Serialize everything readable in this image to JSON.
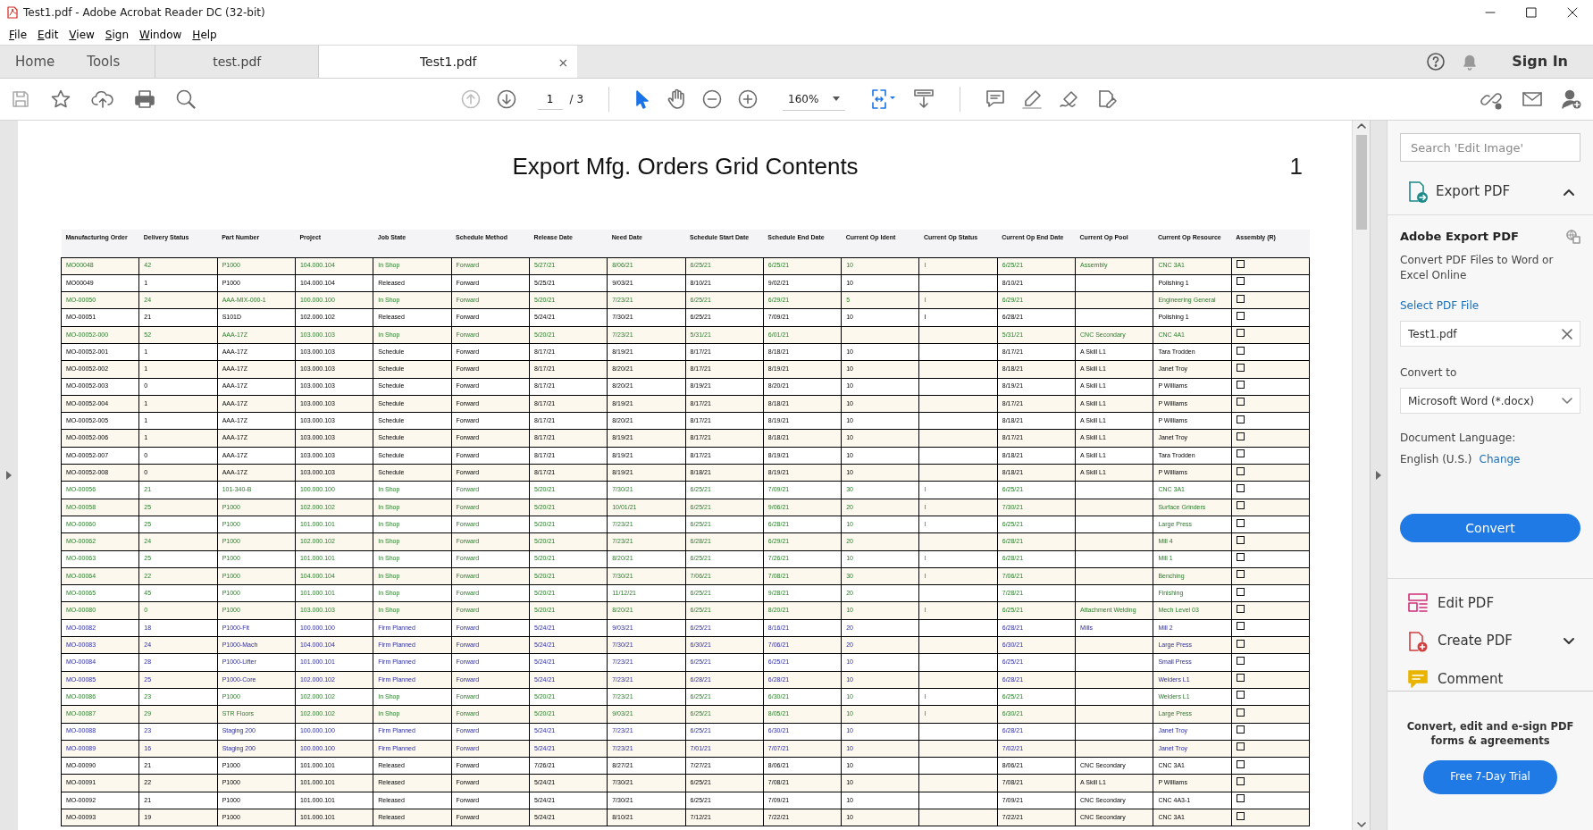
{
  "window": {
    "title": "Test1.pdf - Adobe Acrobat Reader DC (32-bit)"
  },
  "menu": [
    "File",
    "Edit",
    "View",
    "Sign",
    "Window",
    "Help"
  ],
  "tabs": [
    {
      "label": "Home",
      "kind": "nav",
      "selected": false
    },
    {
      "label": "Tools",
      "kind": "nav",
      "selected": false
    },
    {
      "label": "test.pdf",
      "kind": "doc",
      "selected": false
    },
    {
      "label": "Test1.pdf",
      "kind": "doc",
      "selected": true,
      "close": "×"
    }
  ],
  "account": {
    "sign_in": "Sign In"
  },
  "toolbar": {
    "page": "1",
    "page_count": "/ 3",
    "zoom": "160%"
  },
  "document": {
    "title": "Export Mfg. Orders Grid Contents",
    "page_number": "1",
    "table": {
      "columns": [
        "Manufacturing Order",
        "Delivery Status",
        "Part Number",
        "Project",
        "Job State",
        "Schedule Method",
        "Release Date",
        "Need Date",
        "Schedule Start Date",
        "Schedule End Date",
        "Current Op Ident",
        "Current Op Status",
        "Current Op End Date",
        "Current Op Pool",
        "Current Op Resource",
        "Assembly (R)"
      ],
      "rows": [
        {
          "kind": "active",
          "checked": false,
          "cells": [
            "MO00048",
            "42",
            "P1000",
            "104.000.104",
            "In Shop",
            "Forward",
            "5/27/21",
            "8/06/21",
            "6/25/21",
            "6/25/21",
            "10",
            "I",
            "6/25/21",
            "Assembly",
            "CNC 3A1"
          ]
        },
        {
          "kind": "standard",
          "checked": false,
          "cells": [
            "MO00049",
            "1",
            "P1000",
            "104.000.104",
            "Released",
            "Forward",
            "5/25/21",
            "9/03/21",
            "8/10/21",
            "9/02/21",
            "10",
            null,
            "8/10/21",
            null,
            "Polishing 1"
          ]
        },
        {
          "kind": "active",
          "checked": false,
          "cells": [
            "MO-00050",
            "24",
            "AAA-MIX-000-1",
            "100.000.100",
            "In Shop",
            "Forward",
            "5/20/21",
            "7/23/21",
            "6/25/21",
            "6/29/21",
            "5",
            "I",
            "6/29/21",
            null,
            "Engineering General"
          ]
        },
        {
          "kind": "standard",
          "checked": false,
          "cells": [
            "MO-00051",
            "21",
            "S101D",
            "102.000.102",
            "Released",
            "Forward",
            "5/24/21",
            "7/30/21",
            "6/25/21",
            "7/09/21",
            "10",
            "I",
            "6/28/21",
            null,
            "Polishing 1"
          ]
        },
        {
          "kind": "active",
          "checked": false,
          "cells": [
            "MO-00052-000",
            "52",
            "AAA-17Z",
            "103.000.103",
            "In Shop",
            "Forward",
            "5/20/21",
            "7/23/21",
            "5/31/21",
            "6/01/21",
            null,
            null,
            "5/31/21",
            "CNC Secondary",
            "CNC 4A1"
          ]
        },
        {
          "kind": "standard",
          "checked": false,
          "cells": [
            "MO-00052-001",
            "1",
            "AAA-17Z",
            "103.000.103",
            "Schedule",
            "Forward",
            "8/17/21",
            "8/19/21",
            "8/17/21",
            "8/18/21",
            "10",
            null,
            "8/17/21",
            "A Skill L1",
            "Tara Trodden"
          ]
        },
        {
          "kind": "standard",
          "checked": false,
          "cells": [
            "MO-00052-002",
            "1",
            "AAA-17Z",
            "103.000.103",
            "Schedule",
            "Forward",
            "8/17/21",
            "8/20/21",
            "8/17/21",
            "8/19/21",
            "10",
            null,
            "8/18/21",
            "A Skill L1",
            "Janet Troy"
          ]
        },
        {
          "kind": "standard",
          "checked": false,
          "cells": [
            "MO-00052-003",
            "0",
            "AAA-17Z",
            "103.000.103",
            "Schedule",
            "Forward",
            "8/17/21",
            "8/20/21",
            "8/19/21",
            "8/20/21",
            "10",
            null,
            "8/19/21",
            "A Skill L1",
            "P Williams"
          ]
        },
        {
          "kind": "standard",
          "checked": false,
          "cells": [
            "MO-00052-004",
            "1",
            "AAA-17Z",
            "103.000.103",
            "Schedule",
            "Forward",
            "8/17/21",
            "8/19/21",
            "8/17/21",
            "8/18/21",
            "10",
            null,
            "8/17/21",
            "A Skill L1",
            "P Williams"
          ]
        },
        {
          "kind": "standard",
          "checked": false,
          "cells": [
            "MO-00052-005",
            "1",
            "AAA-17Z",
            "103.000.103",
            "Schedule",
            "Forward",
            "8/17/21",
            "8/20/21",
            "8/17/21",
            "8/19/21",
            "10",
            null,
            "8/18/21",
            "A Skill L1",
            "P Williams"
          ]
        },
        {
          "kind": "standard",
          "checked": false,
          "cells": [
            "MO-00052-006",
            "1",
            "AAA-17Z",
            "103.000.103",
            "Schedule",
            "Forward",
            "8/17/21",
            "8/19/21",
            "8/17/21",
            "8/18/21",
            "10",
            null,
            "8/17/21",
            "A Skill L1",
            "Janet Troy"
          ]
        },
        {
          "kind": "standard",
          "checked": false,
          "cells": [
            "MO-00052-007",
            "0",
            "AAA-17Z",
            "103.000.103",
            "Schedule",
            "Forward",
            "8/17/21",
            "8/19/21",
            "8/17/21",
            "8/19/21",
            "10",
            null,
            "8/18/21",
            "A Skill L1",
            "Tara Trodden"
          ]
        },
        {
          "kind": "standard",
          "checked": false,
          "cells": [
            "MO-00052-008",
            "0",
            "AAA-17Z",
            "103.000.103",
            "Schedule",
            "Forward",
            "8/17/21",
            "8/19/21",
            "8/18/21",
            "8/19/21",
            "10",
            null,
            "8/18/21",
            "A Skill L1",
            "P Williams"
          ]
        },
        {
          "kind": "active",
          "checked": false,
          "cells": [
            "MO-00056",
            "21",
            "101-340-B",
            "100.000.100",
            "In Shop",
            "Forward",
            "5/20/21",
            "7/30/21",
            "6/25/21",
            "7/09/21",
            "30",
            "I",
            "6/25/21",
            null,
            "CNC 3A1"
          ]
        },
        {
          "kind": "active",
          "checked": false,
          "cells": [
            "MO-00058",
            "25",
            "P1000",
            "102.000.102",
            "In Shop",
            "Forward",
            "5/20/21",
            "10/01/21",
            "6/25/21",
            "9/06/21",
            "20",
            "I",
            "7/30/21",
            null,
            "Surface Grinders"
          ]
        },
        {
          "kind": "active",
          "checked": false,
          "cells": [
            "MO-00060",
            "25",
            "P1000",
            "101.000.101",
            "In Shop",
            "Forward",
            "5/20/21",
            "7/23/21",
            "6/25/21",
            "6/28/21",
            "10",
            "I",
            "6/25/21",
            null,
            "Large Press"
          ]
        },
        {
          "kind": "active",
          "checked": false,
          "cells": [
            "MO-00062",
            "24",
            "P1000",
            "102.000.102",
            "In Shop",
            "Forward",
            "5/20/21",
            "7/23/21",
            "6/28/21",
            "6/29/21",
            "20",
            null,
            "6/28/21",
            null,
            "Mill 4"
          ]
        },
        {
          "kind": "active",
          "checked": false,
          "cells": [
            "MO-00063",
            "25",
            "P1000",
            "101.000.101",
            "In Shop",
            "Forward",
            "5/20/21",
            "8/20/21",
            "6/25/21",
            "7/26/21",
            "10",
            "I",
            "6/28/21",
            null,
            "Mill 1"
          ]
        },
        {
          "kind": "active",
          "checked": false,
          "cells": [
            "MO-00064",
            "22",
            "P1000",
            "104.000.104",
            "In Shop",
            "Forward",
            "5/20/21",
            "7/30/21",
            "7/06/21",
            "7/08/21",
            "30",
            "I",
            "7/06/21",
            null,
            "Benching"
          ]
        },
        {
          "kind": "active",
          "checked": false,
          "cells": [
            "MO-00065",
            "45",
            "P1000",
            "101.000.101",
            "In Shop",
            "Forward",
            "5/20/21",
            "11/12/21",
            "6/25/21",
            "9/28/21",
            "20",
            null,
            "7/28/21",
            null,
            "Finishing"
          ]
        },
        {
          "kind": "active",
          "checked": false,
          "cells": [
            "MO-00080",
            "0",
            "P1000",
            "103.000.103",
            "In Shop",
            "Forward",
            "5/20/21",
            "8/20/21",
            "6/25/21",
            "8/20/21",
            "10",
            "I",
            "6/25/21",
            "Attachment Welding",
            "Mech Level 03"
          ]
        },
        {
          "kind": "planned",
          "checked": false,
          "cells": [
            "MO-00082",
            "18",
            "P1000-Fit",
            "100.000.100",
            "Firm Planned",
            "Forward",
            "5/24/21",
            "9/03/21",
            "6/25/21",
            "8/16/21",
            "20",
            null,
            "6/28/21",
            "Mills",
            "Mill 2"
          ]
        },
        {
          "kind": "planned",
          "checked": false,
          "cells": [
            "MO-00083",
            "24",
            "P1000-Mach",
            "104.000.104",
            "Firm Planned",
            "Forward",
            "5/24/21",
            "7/30/21",
            "6/30/21",
            "7/06/21",
            "20",
            null,
            "6/30/21",
            null,
            "Large Press"
          ]
        },
        {
          "kind": "planned",
          "checked": false,
          "cells": [
            "MO-00084",
            "28",
            "P1000-Lifter",
            "101.000.101",
            "Firm Planned",
            "Forward",
            "5/24/21",
            "7/23/21",
            "6/25/21",
            "6/25/21",
            "10",
            null,
            "6/25/21",
            null,
            "Small Press"
          ]
        },
        {
          "kind": "planned",
          "checked": false,
          "cells": [
            "MO-00085",
            "25",
            "P1000-Core",
            "102.000.102",
            "Firm Planned",
            "Forward",
            "5/24/21",
            "7/23/21",
            "6/28/21",
            "6/28/21",
            "10",
            null,
            "6/28/21",
            null,
            "Welders L1"
          ]
        },
        {
          "kind": "active",
          "checked": false,
          "cells": [
            "MO-00086",
            "23",
            "P1000",
            "102.000.102",
            "In Shop",
            "Forward",
            "5/20/21",
            "7/23/21",
            "6/25/21",
            "6/30/21",
            "10",
            "I",
            "6/25/21",
            null,
            "Welders L1"
          ]
        },
        {
          "kind": "active",
          "checked": false,
          "cells": [
            "MO-00087",
            "29",
            "STR Floors",
            "102.000.102",
            "In Shop",
            "Forward",
            "5/20/21",
            "9/03/21",
            "6/25/21",
            "8/05/21",
            "10",
            "I",
            "6/30/21",
            null,
            "Large Press"
          ]
        },
        {
          "kind": "planned",
          "checked": false,
          "cells": [
            "MO-00088",
            "23",
            "Staging 200",
            "100.000.100",
            "Firm Planned",
            "Forward",
            "5/24/21",
            "7/23/21",
            "6/25/21",
            "6/30/21",
            "10",
            null,
            "6/28/21",
            null,
            "Janet Troy"
          ]
        },
        {
          "kind": "planned",
          "checked": false,
          "cells": [
            "MO-00089",
            "16",
            "Staging 200",
            "100.000.100",
            "Firm Planned",
            "Forward",
            "5/24/21",
            "7/23/21",
            "7/01/21",
            "7/07/21",
            "10",
            null,
            "7/02/21",
            null,
            "Janet Troy"
          ]
        },
        {
          "kind": "standard",
          "checked": false,
          "cells": [
            "MO-00090",
            "21",
            "P1000",
            "101.000.101",
            "Released",
            "Forward",
            "7/26/21",
            "8/27/21",
            "7/27/21",
            "8/06/21",
            "10",
            null,
            "8/06/21",
            "CNC Secondary",
            "CNC 3A1"
          ]
        },
        {
          "kind": "standard",
          "checked": false,
          "cells": [
            "MO-00091",
            "22",
            "P1000",
            "101.000.101",
            "Released",
            "Forward",
            "5/24/21",
            "7/30/21",
            "6/25/21",
            "7/08/21",
            "10",
            null,
            "7/08/21",
            "A Skill L1",
            "P Williams"
          ]
        },
        {
          "kind": "standard",
          "checked": false,
          "cells": [
            "MO-00092",
            "21",
            "P1000",
            "101.000.101",
            "Released",
            "Forward",
            "5/24/21",
            "7/30/21",
            "6/25/21",
            "7/09/21",
            "10",
            null,
            "7/09/21",
            "CNC Secondary",
            "CNC 4A3-1"
          ]
        },
        {
          "kind": "standard",
          "checked": false,
          "cells": [
            "MO-00093",
            "19",
            "P1000",
            "101.000.101",
            "Released",
            "Forward",
            "5/24/21",
            "8/10/21",
            "7/12/21",
            "7/22/21",
            "10",
            null,
            "7/22/21",
            "CNC Secondary",
            "CNC 3A1"
          ]
        }
      ]
    }
  },
  "panel": {
    "search_placeholder": "Search 'Edit Image'",
    "export_tool": {
      "label": "Export PDF",
      "expanded": true
    },
    "export": {
      "heading": "Adobe Export PDF",
      "description": "Convert PDF Files to Word or Excel Online",
      "select_label": "Select PDF File",
      "file": "Test1.pdf",
      "convert_to_label": "Convert to",
      "format": "Microsoft Word (*.docx)",
      "language_label": "Document Language:",
      "language": "English (U.S.)",
      "change": "Change",
      "convert_button": "Convert"
    },
    "tools": [
      {
        "label": "Edit PDF",
        "kind": "edit",
        "expandable": false
      },
      {
        "label": "Create PDF",
        "kind": "create",
        "expandable": true
      },
      {
        "label": "Comment",
        "kind": "comment",
        "expandable": false
      }
    ],
    "promo": "Convert, edit and e-sign PDF forms & agreements",
    "trial_button": "Free 7-Day Trial"
  }
}
